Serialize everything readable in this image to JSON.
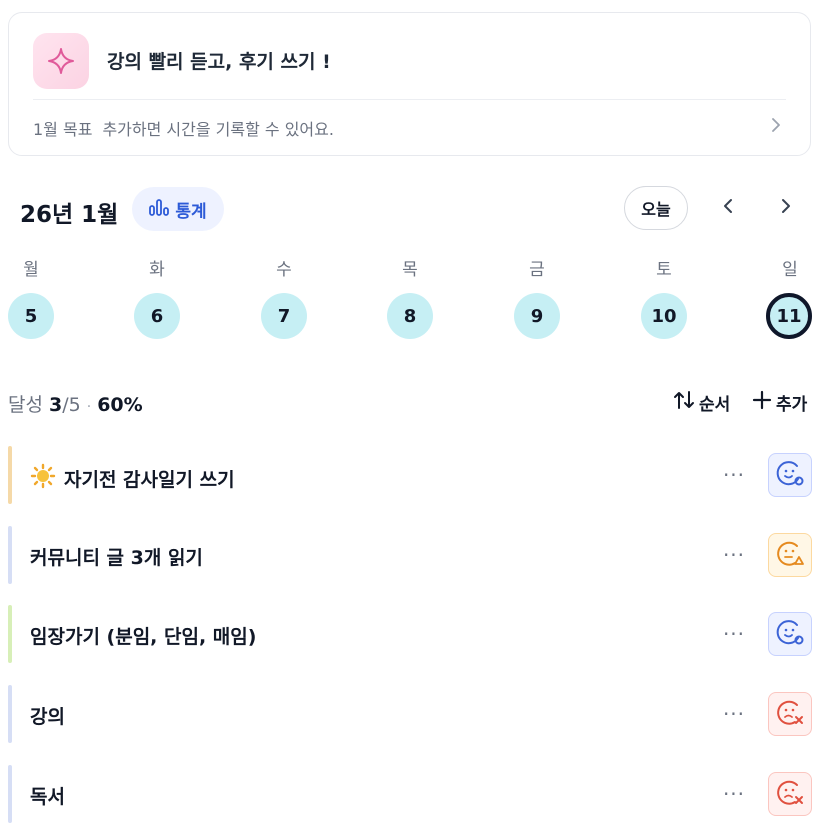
{
  "goal": {
    "title": "강의 빨리 듣고, 후기 쓰기 !",
    "prefix": "1월 목표",
    "subtitle": "추가하면 시간을 기록할 수 있어요.",
    "icon": "sparkle-icon",
    "accent": "#e05a9a"
  },
  "header": {
    "month": "26년 1월",
    "stats_label": "통계",
    "today_label": "오늘"
  },
  "week": {
    "days": [
      {
        "dow": "월",
        "date": "5"
      },
      {
        "dow": "화",
        "date": "6"
      },
      {
        "dow": "수",
        "date": "7"
      },
      {
        "dow": "목",
        "date": "8"
      },
      {
        "dow": "금",
        "date": "9"
      },
      {
        "dow": "토",
        "date": "10"
      },
      {
        "dow": "일",
        "date": "11",
        "today": true
      }
    ]
  },
  "progress": {
    "label": "달성",
    "done": "3",
    "total": "/5",
    "percent": "60%",
    "order_label": "순서",
    "add_label": "추가"
  },
  "tasks": [
    {
      "name": "자기전 감사일기 쓰기",
      "bar_color": "#f5d9a8",
      "status": "done",
      "icon": "sun-icon"
    },
    {
      "name": "커뮤니티 글 3개 읽기",
      "bar_color": "#d6def5",
      "status": "warn"
    },
    {
      "name": "임장가기 (분임, 단임, 매임)",
      "bar_color": "#d7efb8",
      "status": "done"
    },
    {
      "name": "강의",
      "bar_color": "#d6def5",
      "status": "fail"
    },
    {
      "name": "독서",
      "bar_color": "#d6def5",
      "status": "fail"
    }
  ],
  "colors": {
    "done": "#3b63d6",
    "warn": "#e58a1f",
    "fail": "#e0503f",
    "day_bg": "#c6eff4"
  }
}
